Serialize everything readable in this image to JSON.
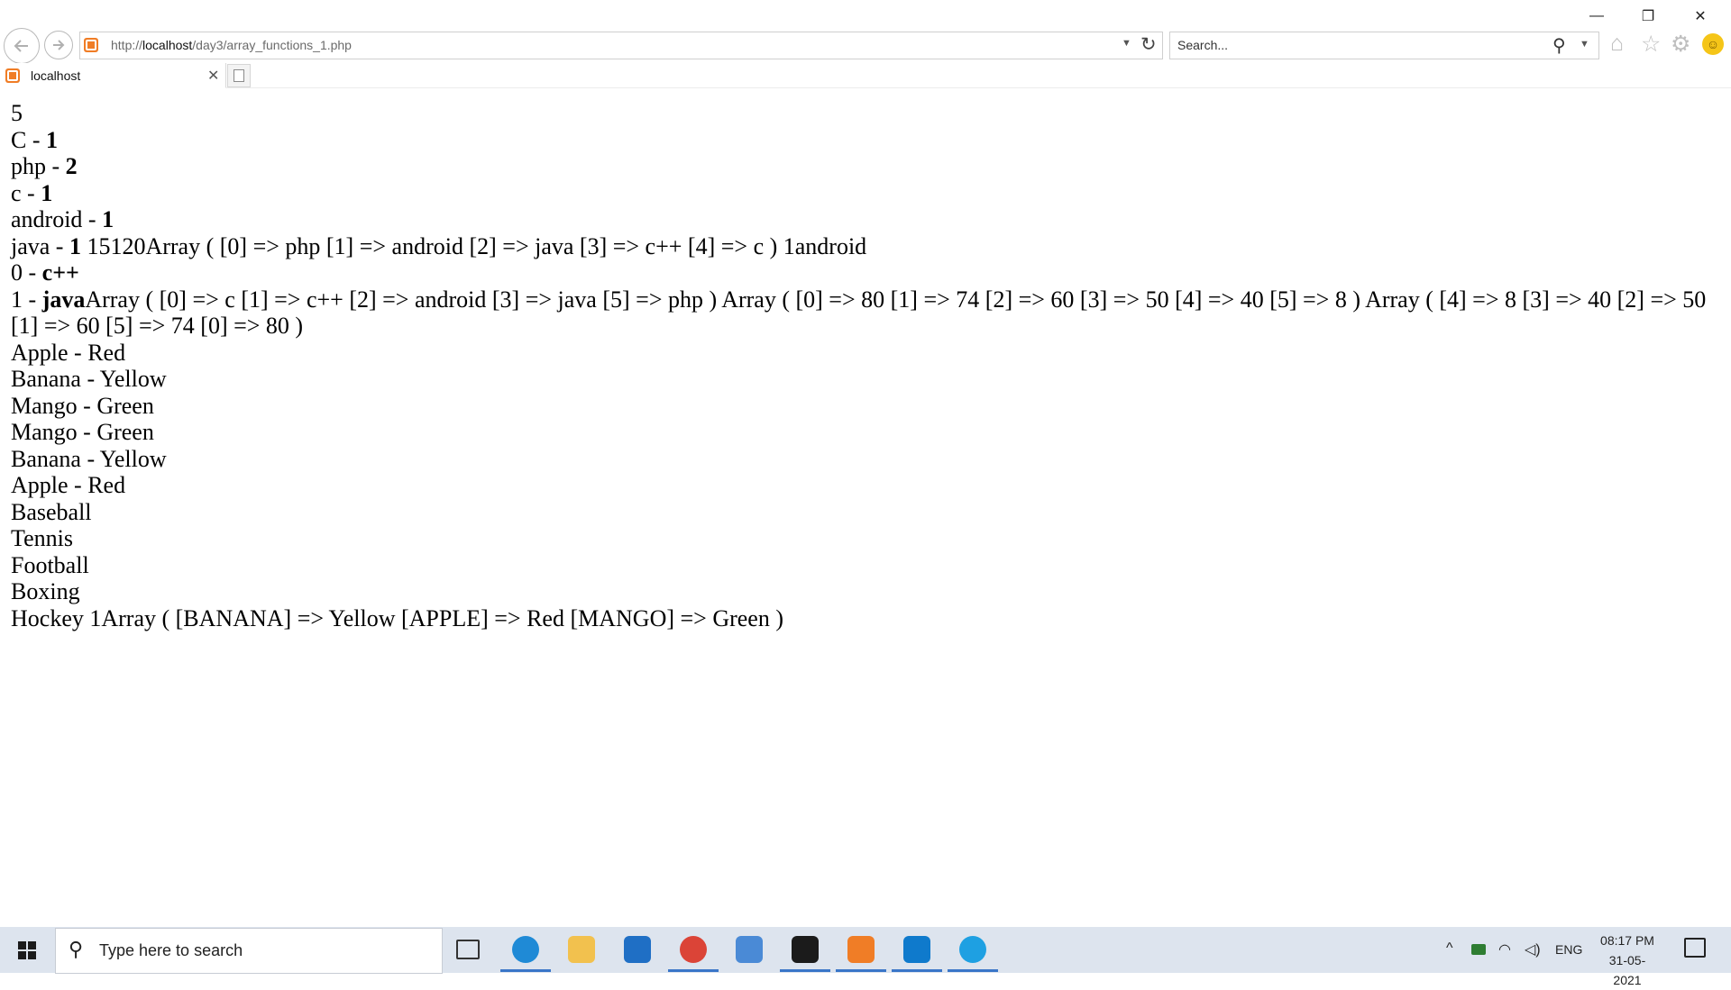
{
  "window": {
    "minimize": "—",
    "maximize": "❐",
    "close": "✕"
  },
  "nav": {
    "back_icon": "back-arrow-icon",
    "forward_icon": "forward-arrow-icon"
  },
  "address": {
    "url_prefix": "http://",
    "url_host": "localhost",
    "url_path": "/day3/array_functions_1.php"
  },
  "search": {
    "placeholder": "Search..."
  },
  "tab": {
    "title": "localhost"
  },
  "content": {
    "lines": [
      [
        {
          "t": "5"
        }
      ],
      [
        {
          "t": "C - "
        },
        {
          "t": "1",
          "b": true
        }
      ],
      [
        {
          "t": "php - "
        },
        {
          "t": "2",
          "b": true
        }
      ],
      [
        {
          "t": "c - "
        },
        {
          "t": "1",
          "b": true
        }
      ],
      [
        {
          "t": "android - "
        },
        {
          "t": "1",
          "b": true
        }
      ],
      [
        {
          "t": "java - "
        },
        {
          "t": "1",
          "b": true
        },
        {
          "t": " 15120Array ( [0] => php [1] => android [2] => java [3] => c++ [4] => c ) 1android"
        }
      ],
      [
        {
          "t": "0 - "
        },
        {
          "t": "c++",
          "b": true
        }
      ],
      [
        {
          "t": "1 - "
        },
        {
          "t": "java",
          "b": true
        },
        {
          "t": "Array ( [0] => c [1] => c++ [2] => android [3] => java [5] => php ) Array ( [0] => 80 [1] => 74 [2] => 60 [3] => 50 [4] => 40 [5] => 8 ) Array ( [4] => 8 [3] => 40 [2] => 50 [1] => 60 [5] => 74 [0] => 80 )"
        }
      ],
      [
        {
          "t": "Apple - Red"
        }
      ],
      [
        {
          "t": "Banana - Yellow"
        }
      ],
      [
        {
          "t": "Mango - Green"
        }
      ],
      [
        {
          "t": "Mango - Green"
        }
      ],
      [
        {
          "t": "Banana - Yellow"
        }
      ],
      [
        {
          "t": "Apple - Red"
        }
      ],
      [
        {
          "t": "Baseball"
        }
      ],
      [
        {
          "t": "Tennis"
        }
      ],
      [
        {
          "t": "Football"
        }
      ],
      [
        {
          "t": "Boxing"
        }
      ],
      [
        {
          "t": "Hockey 1Array ( [BANANA] => Yellow [APPLE] => Red [MANGO] => Green )"
        }
      ]
    ]
  },
  "taskbar": {
    "search_placeholder": "Type here to search",
    "apps": [
      {
        "name": "task-view-icon",
        "color": "#333333"
      },
      {
        "name": "edge-icon",
        "color": "#1f8ad6"
      },
      {
        "name": "file-explorer-icon",
        "color": "#f2c14e"
      },
      {
        "name": "mail-icon",
        "color": "#1f6fc5"
      },
      {
        "name": "chrome-icon",
        "color": "#db4437"
      },
      {
        "name": "app-cube-icon",
        "color": "#4a8ad6"
      },
      {
        "name": "sticky-notes-icon",
        "color": "#1b1b1b"
      },
      {
        "name": "xampp-icon",
        "color": "#f07d26"
      },
      {
        "name": "vscode-icon",
        "color": "#0f7acc"
      },
      {
        "name": "internet-explorer-icon",
        "color": "#1ea0e2"
      }
    ],
    "tray": {
      "language": "ENG",
      "time": "08:17 PM",
      "date": "31-05-2021"
    }
  }
}
